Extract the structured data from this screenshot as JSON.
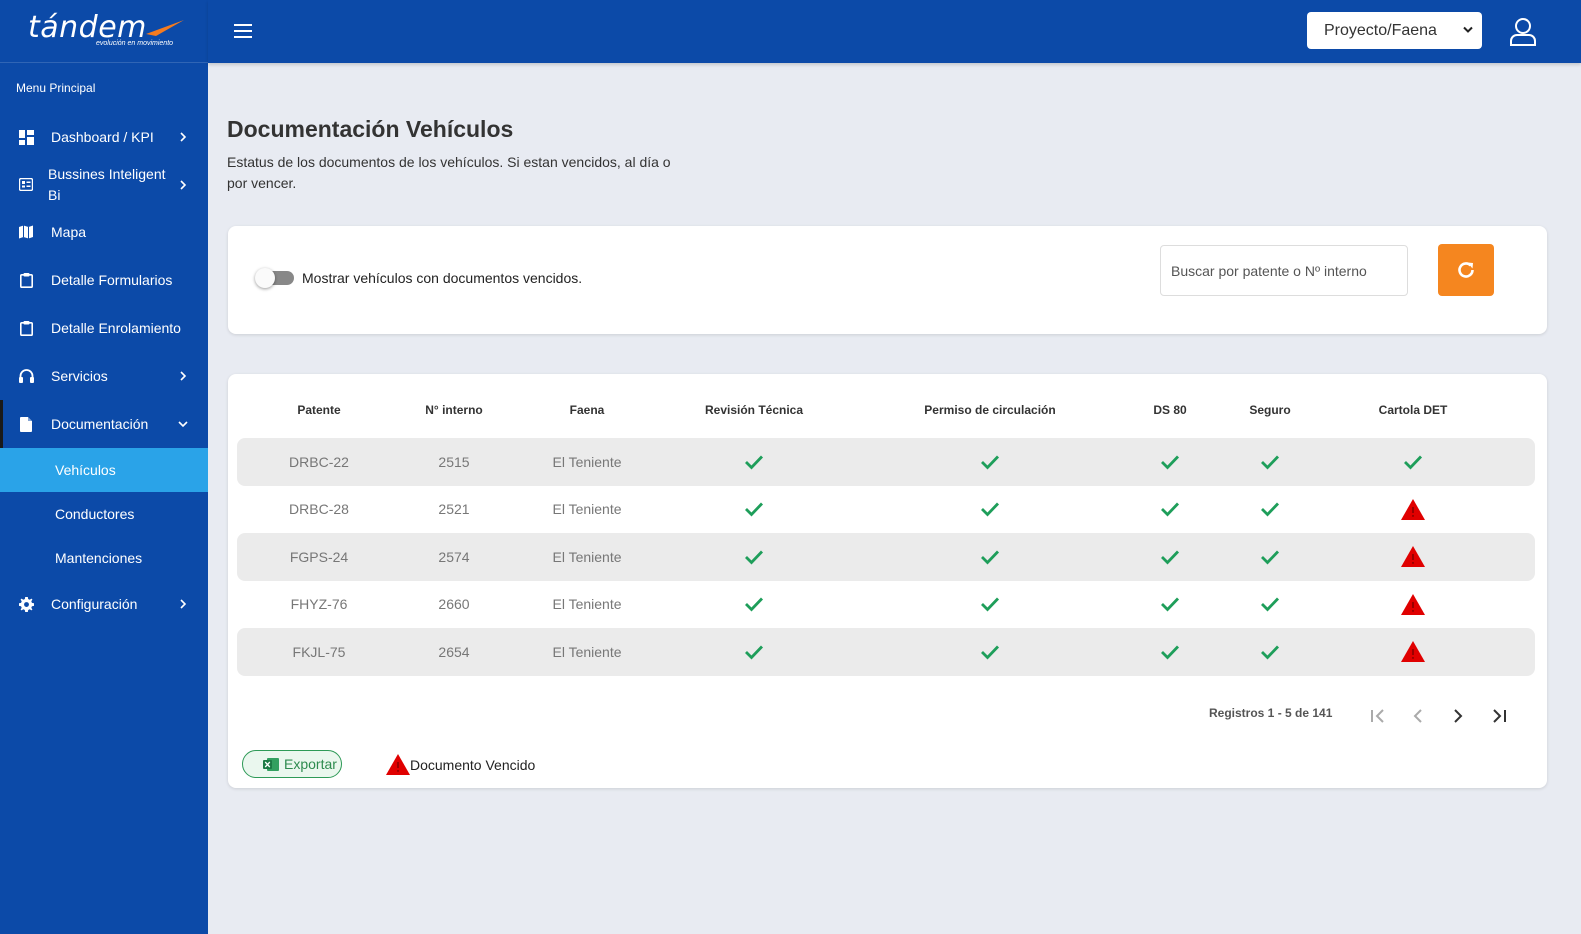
{
  "brand": {
    "name": "tándem",
    "tagline": "evolución en movimiento"
  },
  "sidebar": {
    "menu_title": "Menu Principal",
    "items": [
      {
        "label": "Dashboard / KPI",
        "icon": "dashboard-icon",
        "chevron": "right"
      },
      {
        "label": "Bussines Inteligent Bi",
        "icon": "bi-icon",
        "chevron": "right"
      },
      {
        "label": "Mapa",
        "icon": "map-icon",
        "chevron": ""
      },
      {
        "label": "Detalle Formularios",
        "icon": "clipboard-icon",
        "chevron": ""
      },
      {
        "label": "Detalle Enrolamiento",
        "icon": "clipboard-icon",
        "chevron": ""
      },
      {
        "label": "Servicios",
        "icon": "headset-icon",
        "chevron": "right"
      },
      {
        "label": "Documentación",
        "icon": "document-icon",
        "chevron": "down"
      },
      {
        "label": "Configuración",
        "icon": "gear-icon",
        "chevron": "right"
      }
    ],
    "subitems": [
      {
        "label": "Vehículos",
        "selected": true
      },
      {
        "label": "Conductores",
        "selected": false
      },
      {
        "label": "Mantenciones",
        "selected": false
      }
    ]
  },
  "topbar": {
    "project_select": "Proyecto/Faena"
  },
  "page": {
    "title": "Documentación Vehículos",
    "description": "Estatus de los documentos de los vehículos. Si estan vencidos, al día o por vencer."
  },
  "filters": {
    "toggle_label": "Mostrar vehículos con documentos vencidos.",
    "toggle_on": false,
    "search_placeholder": "Buscar por patente o Nº interno"
  },
  "table": {
    "columns": [
      "Patente",
      "N° interno",
      "Faena",
      "Revisión Técnica",
      "Permiso de circulación",
      "DS 80",
      "Seguro",
      "Cartola DET"
    ],
    "rows": [
      {
        "patente": "DRBC-22",
        "interno": "2515",
        "faena": "El Teniente",
        "docs": [
          "ok",
          "ok",
          "ok",
          "ok",
          "ok"
        ]
      },
      {
        "patente": "DRBC-28",
        "interno": "2521",
        "faena": "El Teniente",
        "docs": [
          "ok",
          "ok",
          "ok",
          "ok",
          "expired"
        ]
      },
      {
        "patente": "FGPS-24",
        "interno": "2574",
        "faena": "El Teniente",
        "docs": [
          "ok",
          "ok",
          "ok",
          "ok",
          "expired"
        ]
      },
      {
        "patente": "FHYZ-76",
        "interno": "2660",
        "faena": "El Teniente",
        "docs": [
          "ok",
          "ok",
          "ok",
          "ok",
          "expired"
        ]
      },
      {
        "patente": "FKJL-75",
        "interno": "2654",
        "faena": "El Teniente",
        "docs": [
          "ok",
          "ok",
          "ok",
          "ok",
          "expired"
        ]
      }
    ]
  },
  "pagination": {
    "info": "Registros 1 - 5 de 141"
  },
  "footer": {
    "export_label": "Exportar",
    "legend_label": "Documento Vencido"
  },
  "colors": {
    "primary": "#0c4aa8",
    "selected": "#2aa3e8",
    "accent": "#f5861f",
    "ok": "#1e9e5a",
    "expired": "#e00000",
    "excel": "#1d7a45"
  }
}
